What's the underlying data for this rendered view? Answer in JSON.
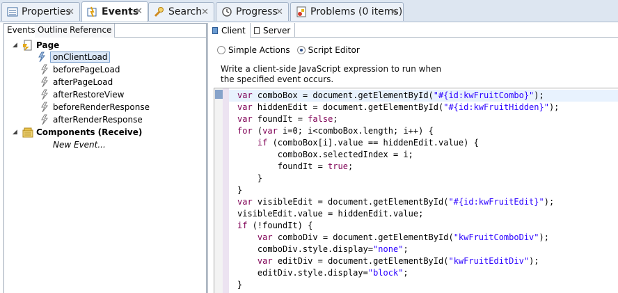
{
  "view_tabs": [
    {
      "label": "Properties",
      "icon": "properties-icon"
    },
    {
      "label": "Events",
      "icon": "events-icon",
      "active": true
    },
    {
      "label": "Search",
      "icon": "search-icon"
    },
    {
      "label": "Progress",
      "icon": "progress-icon"
    },
    {
      "label": "Problems (0 items)",
      "icon": "problems-icon"
    }
  ],
  "close_glyph": "✕",
  "left": {
    "subtabs": [
      "Events",
      "Outline",
      "Reference"
    ],
    "tree": {
      "page": "Page",
      "events": [
        "onClientLoad",
        "beforePageLoad",
        "afterPageLoad",
        "afterRestoreView",
        "beforeRenderResponse",
        "afterRenderResponse"
      ],
      "components": "Components (Receive)",
      "new_event": "New Event..."
    }
  },
  "right": {
    "tabs": [
      "Client",
      "Server"
    ],
    "radio_simple": "Simple Actions",
    "radio_script": "Script Editor",
    "selected_mode": "Script Editor",
    "description": "Write a client-side JavaScript expression to run when the specified event occurs."
  },
  "code_lines": [
    [
      [
        "kw",
        "var"
      ],
      [
        "t",
        " comboBox = document.getElementById("
      ],
      [
        "st",
        "\"#{id:kwFruitCombo}\""
      ],
      [
        "t",
        ");"
      ]
    ],
    [
      [
        "kw",
        "var"
      ],
      [
        "t",
        " hiddenEdit = document.getElementById("
      ],
      [
        "st",
        "\"#{id:kwFruitHidden}\""
      ],
      [
        "t",
        ");"
      ]
    ],
    [
      [
        "kw",
        "var"
      ],
      [
        "t",
        " foundIt = "
      ],
      [
        "kw",
        "false"
      ],
      [
        "t",
        ";"
      ]
    ],
    [
      [
        "kw",
        "for"
      ],
      [
        "t",
        " ("
      ],
      [
        "kw",
        "var"
      ],
      [
        "t",
        " i=0; i<comboBox.length; i++) {"
      ]
    ],
    [
      [
        "t",
        "    "
      ],
      [
        "kw",
        "if"
      ],
      [
        "t",
        " (comboBox[i].value == hiddenEdit.value) {"
      ]
    ],
    [
      [
        "t",
        "        comboBox.selectedIndex = i;"
      ]
    ],
    [
      [
        "t",
        "        foundIt = "
      ],
      [
        "kw",
        "true"
      ],
      [
        "t",
        ";"
      ]
    ],
    [
      [
        "t",
        "    }"
      ]
    ],
    [
      [
        "t",
        "}"
      ]
    ],
    [
      [
        "kw",
        "var"
      ],
      [
        "t",
        " visibleEdit = document.getElementById("
      ],
      [
        "st",
        "\"#{id:kwFruitEdit}\""
      ],
      [
        "t",
        ");"
      ]
    ],
    [
      [
        "t",
        "visibleEdit.value = hiddenEdit.value;"
      ]
    ],
    [
      [
        "kw",
        "if"
      ],
      [
        "t",
        " (!foundIt) {"
      ]
    ],
    [
      [
        "t",
        "    "
      ],
      [
        "kw",
        "var"
      ],
      [
        "t",
        " comboDiv = document.getElementById("
      ],
      [
        "st",
        "\"kwFruitComboDiv\""
      ],
      [
        "t",
        ");"
      ]
    ],
    [
      [
        "t",
        "    comboDiv.style.display="
      ],
      [
        "st",
        "\"none\""
      ],
      [
        "t",
        ";"
      ]
    ],
    [
      [
        "t",
        "    "
      ],
      [
        "kw",
        "var"
      ],
      [
        "t",
        " editDiv = document.getElementById("
      ],
      [
        "st",
        "\"kwFruitEditDiv\""
      ],
      [
        "t",
        ");"
      ]
    ],
    [
      [
        "t",
        "    editDiv.style.display="
      ],
      [
        "st",
        "\"block\""
      ],
      [
        "t",
        ";"
      ]
    ],
    [
      [
        "t",
        "}"
      ]
    ]
  ],
  "colors": {
    "keyword": "#7f0055",
    "string": "#2a00ff",
    "selection": "#dbe7f7"
  }
}
